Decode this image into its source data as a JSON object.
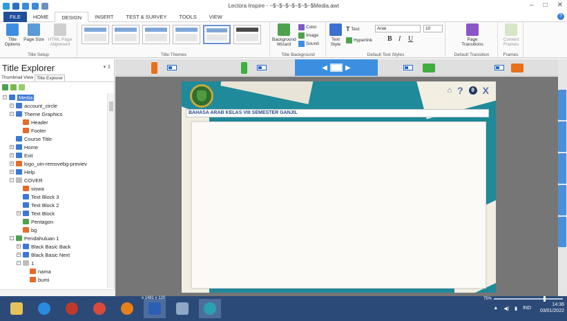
{
  "window": {
    "title": "Lectora Inspire - ~$~$~$~$~$~$~$Media.awt",
    "minimize": "–",
    "maximize": "□",
    "close": "✕"
  },
  "menu_tabs": [
    {
      "label": "FILE"
    },
    {
      "label": "HOME"
    },
    {
      "label": "DESIGN"
    },
    {
      "label": "INSERT"
    },
    {
      "label": "TEST & SURVEY"
    },
    {
      "label": "TOOLS"
    },
    {
      "label": "VIEW"
    }
  ],
  "help_glyph": "?",
  "ribbon": {
    "title_setup": {
      "group_label": "Title Setup",
      "title_options": "Title Options",
      "page_size": "Page Size",
      "html_page_alignment": "HTML Page Alignment"
    },
    "title_themes": {
      "group_label": "Title Themes"
    },
    "title_background": {
      "group_label": "Title Background",
      "background_wizard": "Background Wizard",
      "color": "Color",
      "image": "Image",
      "sound": "Sound"
    },
    "default_text_styles": {
      "group_label": "Default Text Styles",
      "text_style": "Text Style",
      "text": "Text",
      "hyperlink": "Hyperlink",
      "font": "Arial",
      "size": "10",
      "bold": "B",
      "italic": "I",
      "underline": "U"
    },
    "transition": {
      "group_label": "Default Transition",
      "page_transitions": "Page Transitions"
    },
    "frames": {
      "group_label": "Frames",
      "content_frames": "Content Frames"
    }
  },
  "left_panel": {
    "title": "Title Explorer",
    "pin": "▾ ⇕",
    "tabs": [
      "Thumbnail View",
      "Title Explorer"
    ],
    "tree": [
      {
        "label": "Media",
        "depth": 0,
        "icon": "#3b78d8",
        "selected": true,
        "exp": "−"
      },
      {
        "label": "account_circle",
        "depth": 1,
        "icon": "#3b78d8",
        "exp": "+"
      },
      {
        "label": "Theme Graphics",
        "depth": 1,
        "icon": "#3b78d8",
        "exp": "−"
      },
      {
        "label": "Header",
        "depth": 2,
        "icon": "#e86a2a",
        "exp": ""
      },
      {
        "label": "Footer",
        "depth": 2,
        "icon": "#e86a2a",
        "exp": ""
      },
      {
        "label": "Course Title",
        "depth": 1,
        "icon": "#3b78d8",
        "exp": ""
      },
      {
        "label": "Home",
        "depth": 1,
        "icon": "#3b78d8",
        "exp": "+"
      },
      {
        "label": "Exit",
        "depth": 1,
        "icon": "#3b78d8",
        "exp": "+"
      },
      {
        "label": "logo_uin-removebg-previev",
        "depth": 1,
        "icon": "#e86a2a",
        "exp": "+"
      },
      {
        "label": "Help",
        "depth": 1,
        "icon": "#3b78d8",
        "exp": "+"
      },
      {
        "label": "COVER",
        "depth": 1,
        "icon": "#bdbdbd",
        "exp": "−"
      },
      {
        "label": "siswa",
        "depth": 2,
        "icon": "#e86a2a",
        "exp": ""
      },
      {
        "label": "Text Block 3",
        "depth": 2,
        "icon": "#3b78d8",
        "exp": ""
      },
      {
        "label": "Text Block 2",
        "depth": 2,
        "icon": "#3b78d8",
        "exp": ""
      },
      {
        "label": "Text Block",
        "depth": 2,
        "icon": "#3b78d8",
        "exp": "+"
      },
      {
        "label": "Pentagon",
        "depth": 2,
        "icon": "#4ea24e",
        "exp": ""
      },
      {
        "label": "bg",
        "depth": 2,
        "icon": "#e86a2a",
        "exp": ""
      },
      {
        "label": "Pendahuluan 1",
        "depth": 1,
        "icon": "#4ea24e",
        "exp": "−"
      },
      {
        "label": "Black Basic Back",
        "depth": 2,
        "icon": "#3b78d8",
        "exp": "+"
      },
      {
        "label": "Black Basic Next",
        "depth": 2,
        "icon": "#3b78d8",
        "exp": "+"
      },
      {
        "label": "1",
        "depth": 2,
        "icon": "#bdbdbd",
        "exp": "−"
      },
      {
        "label": "nama",
        "depth": 3,
        "icon": "#e86a2a",
        "exp": ""
      },
      {
        "label": "bumi",
        "depth": 3,
        "icon": "#e86a2a",
        "exp": ""
      }
    ]
  },
  "device_bar": [
    {
      "name": "phone-portrait",
      "color": "#e8701a",
      "active": false
    },
    {
      "name": "phone-landscape-toggle",
      "active": false
    },
    {
      "name": "phone-green",
      "color": "#3fae3f",
      "active": false
    },
    {
      "name": "desktop",
      "active": true
    },
    {
      "name": "tablet-green",
      "color": "#3fae3f",
      "active": false
    },
    {
      "name": "tablet-orange",
      "color": "#e8701a",
      "active": false
    }
  ],
  "slide": {
    "heading": "BAHASA ARAB KELAS VIII SEMESTER GANJIL",
    "nav": {
      "home": "⌂",
      "help": "?",
      "user": "θ",
      "close": "X"
    }
  },
  "status": {
    "coords": "x 1481 y 120",
    "zoom": "75%"
  },
  "taskbar": {
    "time": "14:36",
    "date": "03/01/2022",
    "lang": "IND"
  }
}
